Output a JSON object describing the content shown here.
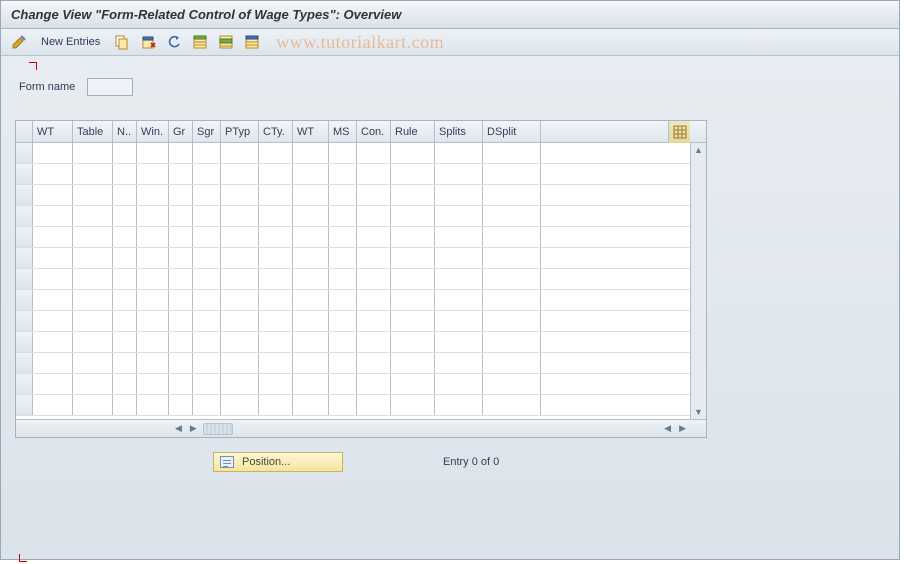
{
  "title": "Change View \"Form-Related Control of Wage Types\": Overview",
  "toolbar": {
    "new_entries_label": "New Entries"
  },
  "watermark": "www.tutorialkart.com",
  "form": {
    "label": "Form name",
    "value": ""
  },
  "grid": {
    "columns": [
      {
        "key": "wt1",
        "label": "WT",
        "width": 40
      },
      {
        "key": "table",
        "label": "Table",
        "width": 40
      },
      {
        "key": "n",
        "label": "N..",
        "width": 24
      },
      {
        "key": "win",
        "label": "Win.",
        "width": 32
      },
      {
        "key": "gr",
        "label": "Gr",
        "width": 24
      },
      {
        "key": "sgr",
        "label": "Sgr",
        "width": 28
      },
      {
        "key": "ptyp",
        "label": "PTyp",
        "width": 38
      },
      {
        "key": "cty",
        "label": "CTy.",
        "width": 34
      },
      {
        "key": "wt2",
        "label": "WT",
        "width": 36
      },
      {
        "key": "ms",
        "label": "MS",
        "width": 28
      },
      {
        "key": "con",
        "label": "Con.",
        "width": 34
      },
      {
        "key": "rule",
        "label": "Rule",
        "width": 44
      },
      {
        "key": "splits",
        "label": "Splits",
        "width": 48
      },
      {
        "key": "dsplit",
        "label": "DSplit",
        "width": 58
      }
    ],
    "row_count": 13
  },
  "footer": {
    "position_label": "Position...",
    "entry_count": "Entry 0 of 0"
  },
  "icons": {
    "pencil": "pencil-icon",
    "copy": "copy-icon",
    "save": "save-icon",
    "undo": "undo-icon",
    "select_all": "select-all-icon",
    "select_block": "select-block-icon",
    "deselect": "deselect-icon",
    "table_settings": "table-settings-icon"
  }
}
